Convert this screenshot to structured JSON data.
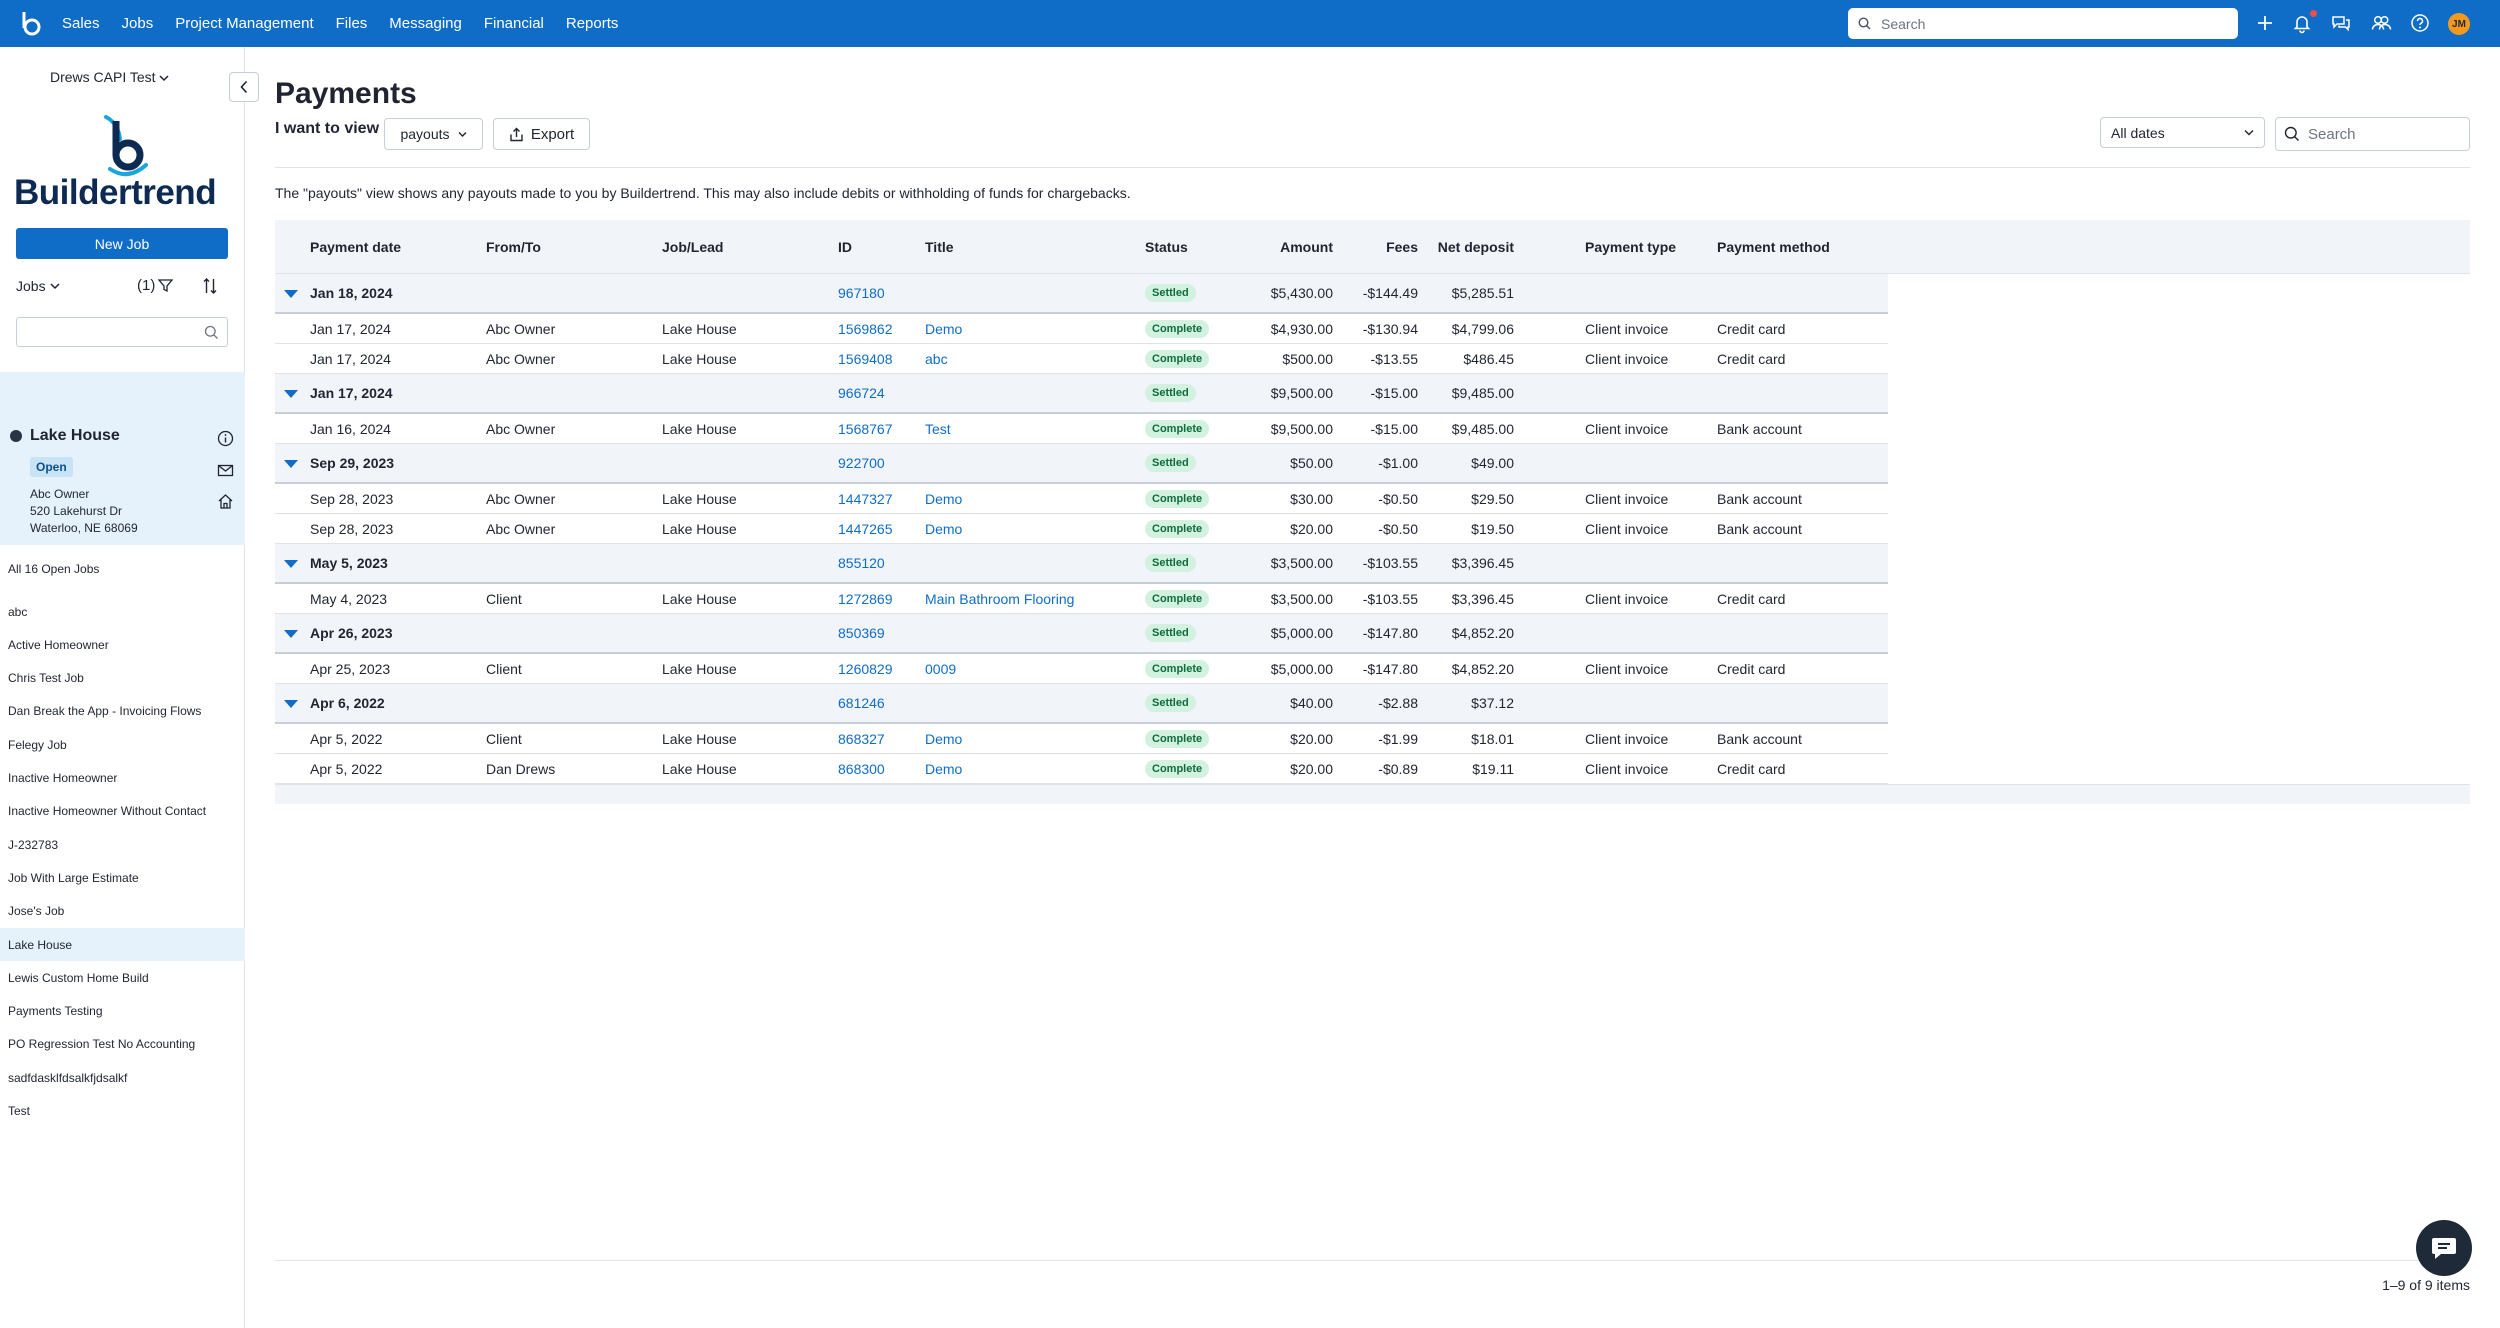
{
  "topbar": {
    "nav": [
      "Sales",
      "Jobs",
      "Project Management",
      "Files",
      "Messaging",
      "Financial",
      "Reports"
    ],
    "search_placeholder": "Search",
    "avatar_initials": "JM",
    "brand_color": "#0f6dc7"
  },
  "sidebar": {
    "company": "Drews CAPI Test",
    "brand_name": "Buildertrend",
    "new_job": "New Job",
    "jobs_filter": "Jobs",
    "filter_count": "(1)",
    "selected_job": {
      "name": "Lake House",
      "status": "Open",
      "owner": "Abc Owner",
      "street": "520 Lakehurst Dr",
      "city": "Waterloo, NE 68069"
    },
    "open_jobs_label": "All 16 Open Jobs",
    "jobs": [
      "abc",
      "Active Homeowner",
      "Chris Test Job",
      "Dan Break the App - Invoicing Flows",
      "Felegy Job",
      "Inactive Homeowner",
      "Inactive Homeowner Without Contact",
      "J-232783",
      "Job With Large Estimate",
      "Jose's Job",
      "Lake House",
      "Lewis Custom Home Build",
      "Payments Testing",
      "PO Regression Test No Accounting",
      "sadfdasklfdsalkfjdsalkf",
      "Test"
    ],
    "active_job_index": 10
  },
  "main": {
    "title": "Payments",
    "view_label": "I want to view",
    "view_value": "payouts",
    "export": "Export",
    "dates_value": "All dates",
    "search_placeholder": "Search",
    "description": "The \"payouts\" view shows any payouts made to you by Buildertrend. This may also include debits or withholding of funds for chargebacks.",
    "columns": {
      "payment_date": "Payment date",
      "from_to": "From/To",
      "job_lead": "Job/Lead",
      "id": "ID",
      "title": "Title",
      "status": "Status",
      "amount": "Amount",
      "fees": "Fees",
      "net_deposit": "Net deposit",
      "payment_type": "Payment type",
      "payment_method": "Payment method"
    },
    "groups": [
      {
        "date": "Jan 18, 2024",
        "id": "967180",
        "status": "Settled",
        "amount": "$5,430.00",
        "fees": "-$144.49",
        "net": "$5,285.51",
        "rows": [
          {
            "date": "Jan 17, 2024",
            "from": "Abc Owner",
            "job": "Lake House",
            "id": "1569862",
            "title": "Demo",
            "status": "Complete",
            "amount": "$4,930.00",
            "fees": "-$130.94",
            "net": "$4,799.06",
            "type": "Client invoice",
            "method": "Credit card"
          },
          {
            "date": "Jan 17, 2024",
            "from": "Abc Owner",
            "job": "Lake House",
            "id": "1569408",
            "title": "abc",
            "status": "Complete",
            "amount": "$500.00",
            "fees": "-$13.55",
            "net": "$486.45",
            "type": "Client invoice",
            "method": "Credit card"
          }
        ]
      },
      {
        "date": "Jan 17, 2024",
        "id": "966724",
        "status": "Settled",
        "amount": "$9,500.00",
        "fees": "-$15.00",
        "net": "$9,485.00",
        "rows": [
          {
            "date": "Jan 16, 2024",
            "from": "Abc Owner",
            "job": "Lake House",
            "id": "1568767",
            "title": "Test",
            "status": "Complete",
            "amount": "$9,500.00",
            "fees": "-$15.00",
            "net": "$9,485.00",
            "type": "Client invoice",
            "method": "Bank account"
          }
        ]
      },
      {
        "date": "Sep 29, 2023",
        "id": "922700",
        "status": "Settled",
        "amount": "$50.00",
        "fees": "-$1.00",
        "net": "$49.00",
        "rows": [
          {
            "date": "Sep 28, 2023",
            "from": "Abc Owner",
            "job": "Lake House",
            "id": "1447327",
            "title": "Demo",
            "status": "Complete",
            "amount": "$30.00",
            "fees": "-$0.50",
            "net": "$29.50",
            "type": "Client invoice",
            "method": "Bank account"
          },
          {
            "date": "Sep 28, 2023",
            "from": "Abc Owner",
            "job": "Lake House",
            "id": "1447265",
            "title": "Demo",
            "status": "Complete",
            "amount": "$20.00",
            "fees": "-$0.50",
            "net": "$19.50",
            "type": "Client invoice",
            "method": "Bank account"
          }
        ]
      },
      {
        "date": "May 5, 2023",
        "id": "855120",
        "status": "Settled",
        "amount": "$3,500.00",
        "fees": "-$103.55",
        "net": "$3,396.45",
        "rows": [
          {
            "date": "May 4, 2023",
            "from": "Client",
            "job": "Lake House",
            "id": "1272869",
            "title": "Main Bathroom Flooring",
            "status": "Complete",
            "amount": "$3,500.00",
            "fees": "-$103.55",
            "net": "$3,396.45",
            "type": "Client invoice",
            "method": "Credit card"
          }
        ]
      },
      {
        "date": "Apr 26, 2023",
        "id": "850369",
        "status": "Settled",
        "amount": "$5,000.00",
        "fees": "-$147.80",
        "net": "$4,852.20",
        "rows": [
          {
            "date": "Apr 25, 2023",
            "from": "Client",
            "job": "Lake House",
            "id": "1260829",
            "title": "0009",
            "status": "Complete",
            "amount": "$5,000.00",
            "fees": "-$147.80",
            "net": "$4,852.20",
            "type": "Client invoice",
            "method": "Credit card"
          }
        ]
      },
      {
        "date": "Apr 6, 2022",
        "id": "681246",
        "status": "Settled",
        "amount": "$40.00",
        "fees": "-$2.88",
        "net": "$37.12",
        "rows": [
          {
            "date": "Apr 5, 2022",
            "from": "Client",
            "job": "Lake House",
            "id": "868327",
            "title": "Demo",
            "status": "Complete",
            "amount": "$20.00",
            "fees": "-$1.99",
            "net": "$18.01",
            "type": "Client invoice",
            "method": "Bank account"
          },
          {
            "date": "Apr 5, 2022",
            "from": "Dan Drews",
            "job": "Lake House",
            "id": "868300",
            "title": "Demo",
            "status": "Complete",
            "amount": "$20.00",
            "fees": "-$0.89",
            "net": "$19.11",
            "type": "Client invoice",
            "method": "Credit card"
          }
        ]
      }
    ],
    "pager": "1–9 of 9 items"
  }
}
